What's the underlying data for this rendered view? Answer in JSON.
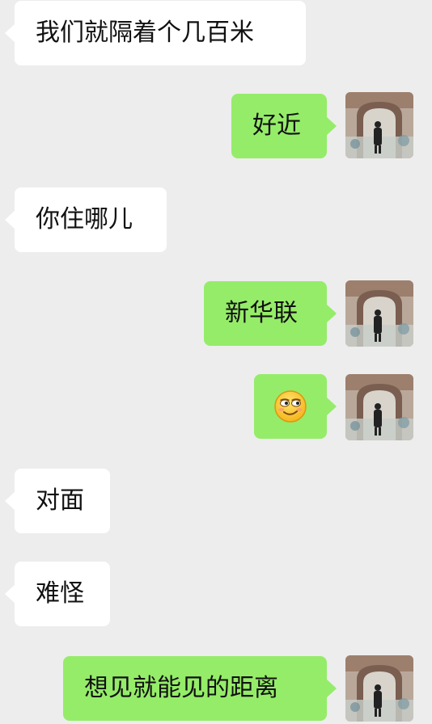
{
  "chat": {
    "messages": [
      {
        "side": "incoming",
        "text": "我们就隔着个几百米"
      },
      {
        "side": "outgoing",
        "text": "好近"
      },
      {
        "side": "incoming",
        "text": "你住哪儿"
      },
      {
        "side": "outgoing",
        "text": "新华联"
      },
      {
        "side": "outgoing",
        "text": "",
        "emoji": "smirk-emoji"
      },
      {
        "side": "incoming",
        "text": "对面"
      },
      {
        "side": "incoming",
        "text": "难怪"
      },
      {
        "side": "outgoing",
        "text": "想见就能见的距离"
      }
    ]
  },
  "colors": {
    "background": "#ededed",
    "incoming_bubble": "#ffffff",
    "outgoing_bubble": "#95ec69",
    "text": "#111111"
  }
}
